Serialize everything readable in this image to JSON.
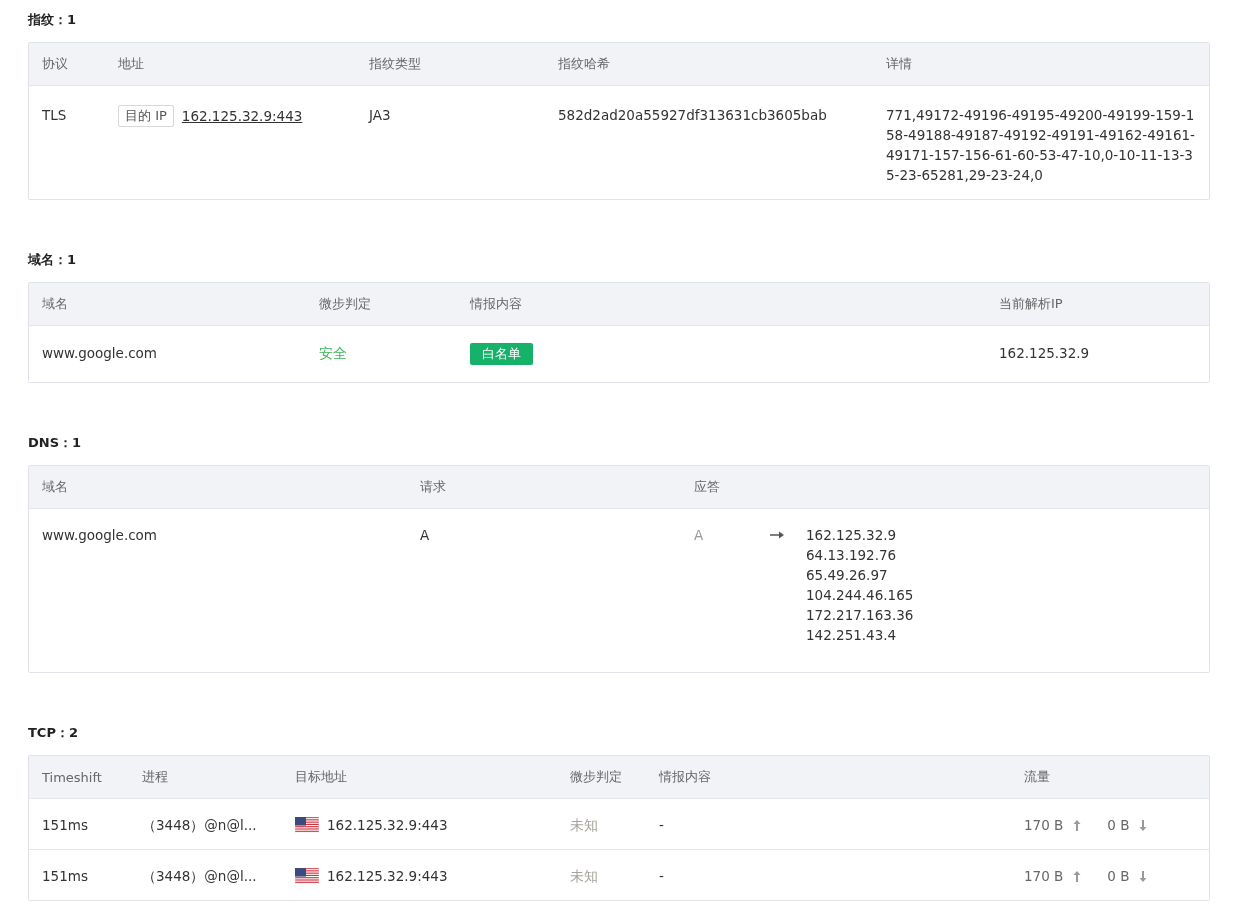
{
  "fingerprint": {
    "title": "指纹：1",
    "columns": [
      "协议",
      "地址",
      "指纹类型",
      "指纹哈希",
      "详情"
    ],
    "rows": [
      {
        "protocol": "TLS",
        "address_tag": "目的 IP",
        "address": "162.125.32.9:443",
        "type": "JA3",
        "hash": "582d2ad20a55927df313631cb3605bab",
        "detail": "771,49172-49196-49195-49200-49199-159-158-49188-49187-49192-49191-49162-49161-49171-157-156-61-60-53-47-10,0-10-11-13-35-23-65281,29-23-24,0"
      }
    ]
  },
  "domains": {
    "title": "域名：1",
    "columns": [
      "域名",
      "微步判定",
      "情报内容",
      "当前解析IP"
    ],
    "rows": [
      {
        "domain": "www.google.com",
        "verdict": {
          "text": "安全",
          "kind": "safe"
        },
        "intel_tag": "白名单",
        "ip": "162.125.32.9"
      }
    ]
  },
  "dns": {
    "title": "DNS：1",
    "columns": [
      "域名",
      "请求",
      "应答"
    ],
    "rows": [
      {
        "domain": "www.google.com",
        "request": "A",
        "answer_type": "A",
        "answers": [
          "162.125.32.9",
          "64.13.192.76",
          "65.49.26.97",
          "104.244.46.165",
          "172.217.163.36",
          "142.251.43.4"
        ]
      }
    ]
  },
  "tcp": {
    "title": "TCP：2",
    "columns": [
      "Timeshift",
      "进程",
      "目标地址",
      "微步判定",
      "情报内容",
      "流量"
    ],
    "rows": [
      {
        "timeshift": "151ms",
        "process": "（3448）@n@l...",
        "target": "162.125.32.9:443",
        "verdict": {
          "text": "未知",
          "kind": "unknown"
        },
        "intel": "-",
        "up": "170 B",
        "down": "0 B"
      },
      {
        "timeshift": "151ms",
        "process": "（3448）@n@l...",
        "target": "162.125.32.9:443",
        "verdict": {
          "text": "未知",
          "kind": "unknown"
        },
        "intel": "-",
        "up": "170 B",
        "down": "0 B"
      }
    ]
  }
}
